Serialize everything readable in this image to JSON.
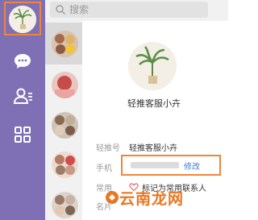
{
  "search": {
    "placeholder": "搜索"
  },
  "profile": {
    "name": "轻推客服小卉"
  },
  "details": {
    "account_label": "轻推号",
    "account_value": "轻推客服小卉",
    "phone_label": "手机",
    "phone_edit": "修改",
    "common_label": "常用",
    "favorite_text": "标记为常用联系人",
    "card_label": "名片"
  },
  "watermark": {
    "text": "云南龙网"
  },
  "colors": {
    "rail": "#7f6fb4",
    "highlight": "#f0853a",
    "link": "#3b7fd9",
    "watermark": "#e87722"
  }
}
